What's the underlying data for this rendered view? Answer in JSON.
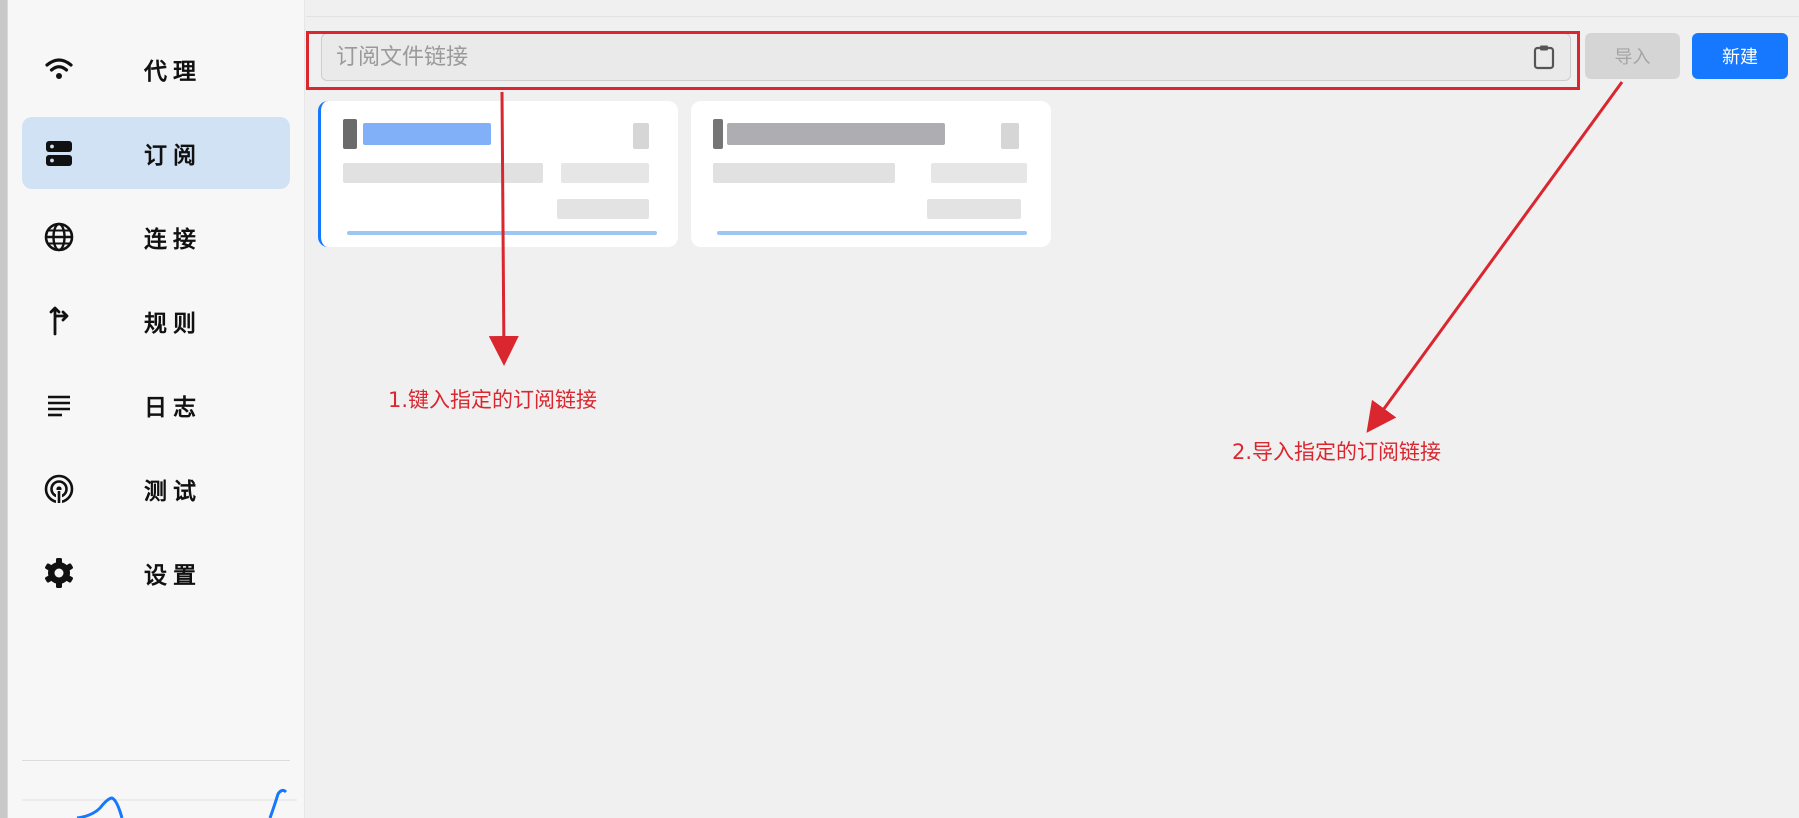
{
  "sidebar": {
    "items": [
      {
        "label": "代理",
        "icon": "wifi-icon",
        "active": false
      },
      {
        "label": "订阅",
        "icon": "server-icon",
        "active": true
      },
      {
        "label": "连接",
        "icon": "globe-icon",
        "active": false
      },
      {
        "label": "规则",
        "icon": "route-icon",
        "active": false
      },
      {
        "label": "日志",
        "icon": "notes-icon",
        "active": false
      },
      {
        "label": "测试",
        "icon": "radar-icon",
        "active": false
      },
      {
        "label": "设置",
        "icon": "gear-icon",
        "active": false
      }
    ]
  },
  "subscription": {
    "input_value": "",
    "input_placeholder": "订阅文件链接",
    "paste_icon": "clipboard-icon",
    "import_label": "导入",
    "new_label": "新建"
  },
  "annotations": {
    "step1": "1.键入指定的订阅链接",
    "step2": "2.导入指定的订阅链接"
  },
  "colors": {
    "accent": "#1677ff",
    "active_nav": "#d1e2f4",
    "annotation": "#d9262f"
  }
}
